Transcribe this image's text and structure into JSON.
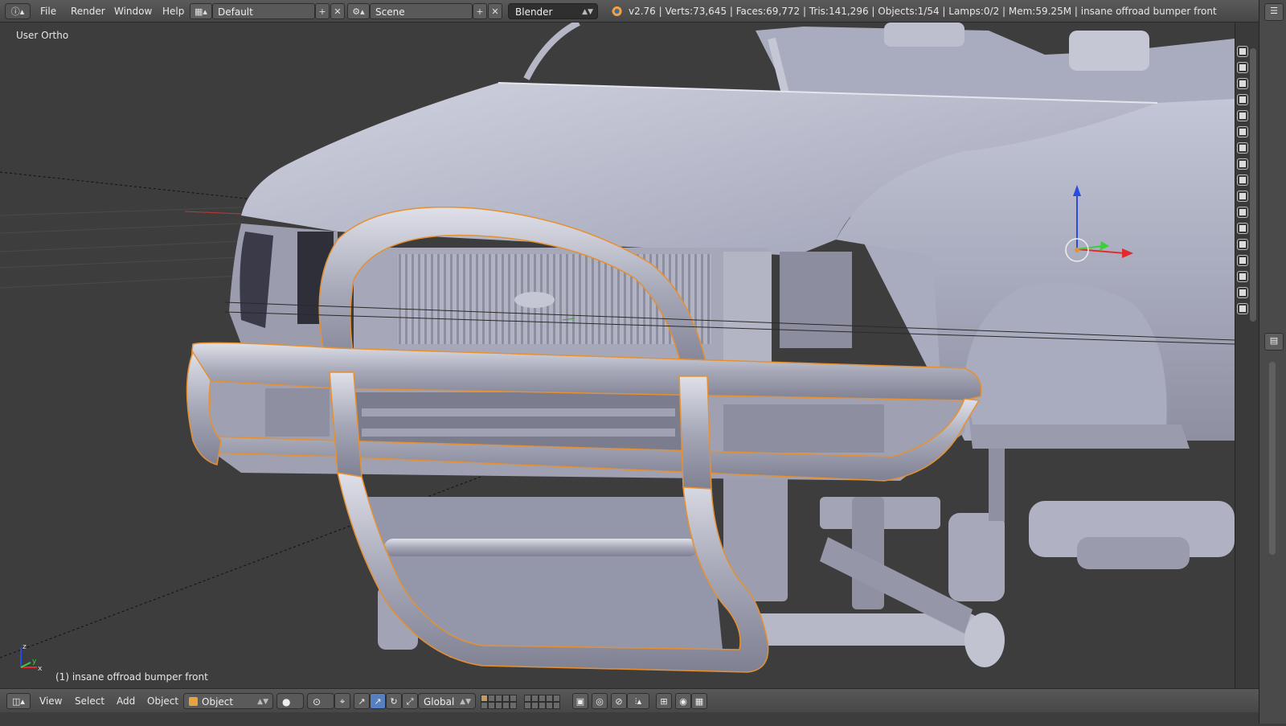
{
  "header": {
    "editor_icon": "info-icon",
    "menus": [
      "File",
      "Render",
      "Window",
      "Help"
    ],
    "screen_layout": "Default",
    "scene": "Scene",
    "render_engine": "Blender Render",
    "stats": "v2.76 | Verts:73,645 | Faces:69,772 | Tris:141,296 | Objects:1/54 | Lamps:0/2 | Mem:59.25M | insane offroad bumper front"
  },
  "viewport": {
    "view_label": "User Ortho",
    "object_label": "(1) insane offroad bumper front",
    "axis_labels": {
      "x": "x",
      "y": "y",
      "z": "z"
    }
  },
  "footer": {
    "menus": [
      "View",
      "Select",
      "Add",
      "Object"
    ],
    "mode": "Object Mode",
    "orientation": "Global"
  },
  "colors": {
    "selection_outline": "#e6902f",
    "axis_x": "#e02c2c",
    "axis_y": "#3ccf3c",
    "axis_z": "#2a4be0",
    "model": "#b4b7c9"
  }
}
